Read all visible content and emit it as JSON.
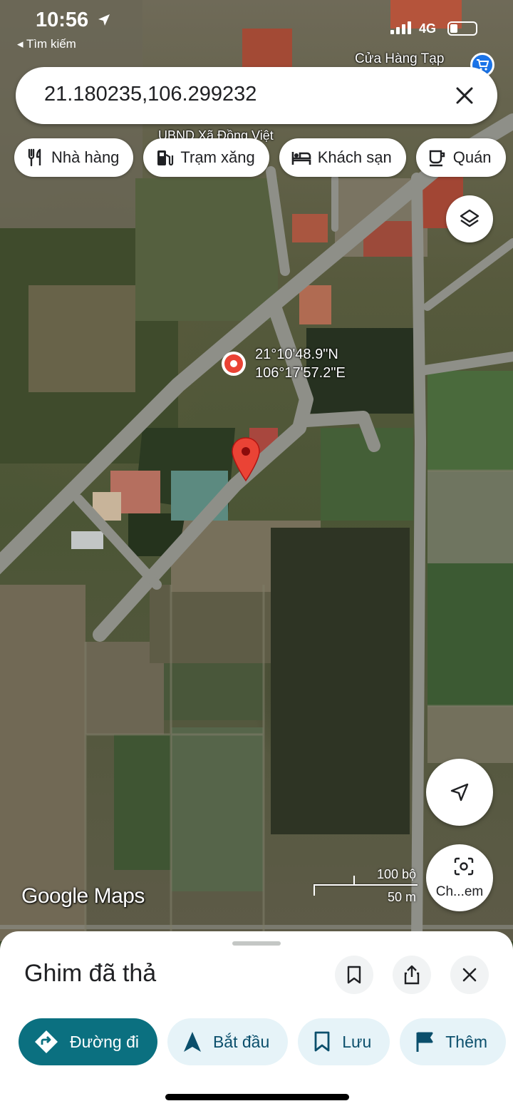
{
  "status_bar": {
    "time": "10:56",
    "back_label": "◂ Tìm kiếm",
    "network": "4G"
  },
  "map": {
    "poi_store": "Cửa Hàng Tạp",
    "poi_office": "UBND Xã Đồng Việt",
    "coordinate_label_lat": "21°10'48.9\"N",
    "coordinate_label_lng": "106°17'57.2\"E",
    "pin_color": "#ea4335",
    "scale_imperial": "100 bộ",
    "scale_metric": "50 m",
    "logo": "Google Maps"
  },
  "search": {
    "value": "21.180235,106.299232"
  },
  "chips": [
    {
      "label": "Nhà hàng",
      "icon": "restaurant-icon"
    },
    {
      "label": "Trạm xăng",
      "icon": "gas-station-icon"
    },
    {
      "label": "Khách sạn",
      "icon": "hotel-icon"
    },
    {
      "label": "Quán",
      "icon": "cafe-icon"
    }
  ],
  "lens": {
    "label": "Ch...em"
  },
  "sheet": {
    "title": "Ghim đã thả",
    "actions": [
      {
        "label": "Đường đi",
        "icon": "directions-icon"
      },
      {
        "label": "Bắt đầu",
        "icon": "navigation-arrow-icon"
      },
      {
        "label": "Lưu",
        "icon": "bookmark-icon"
      },
      {
        "label": "Thêm",
        "icon": "flag-icon"
      }
    ]
  },
  "colors": {
    "accent": "#0b7080",
    "secondary_action_bg": "#e6f3f8",
    "secondary_action_text": "#0b4f6c"
  }
}
